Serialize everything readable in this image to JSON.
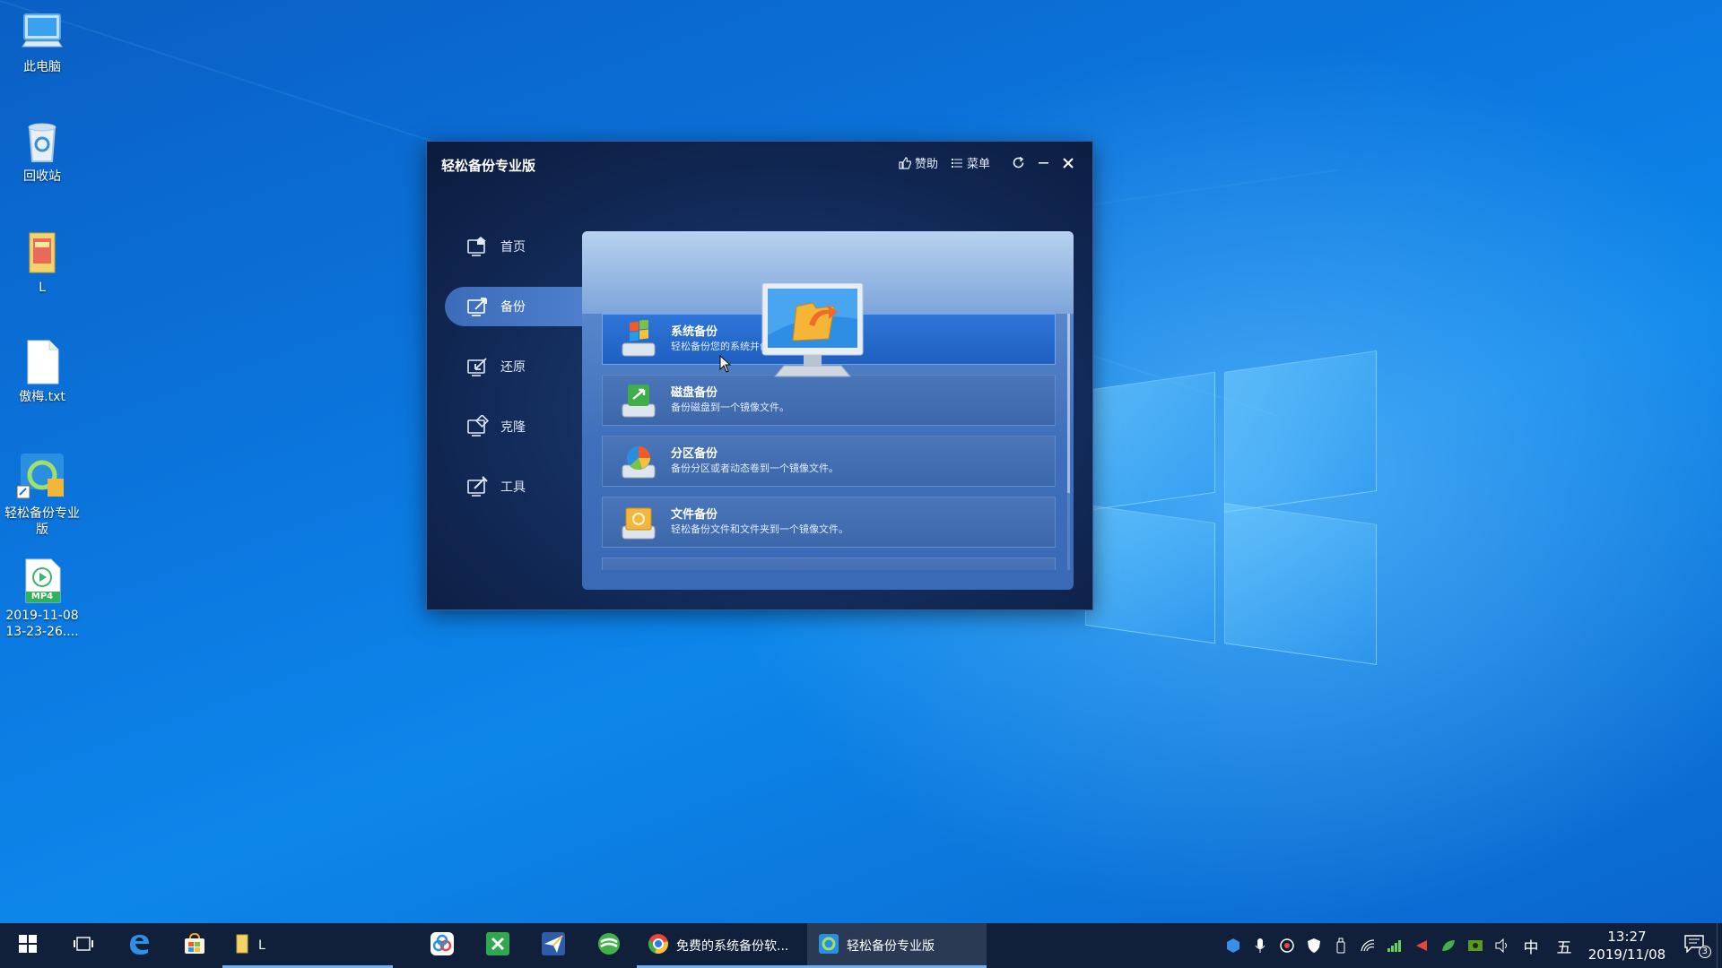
{
  "desktop": {
    "icons": [
      {
        "label": "此电脑",
        "icon": "computer-icon"
      },
      {
        "label": "回收站",
        "icon": "recycle-bin-icon"
      },
      {
        "label": "L",
        "icon": "folder-icon"
      },
      {
        "label": "傲梅.txt",
        "icon": "text-file-icon"
      },
      {
        "label": "轻松备份专业版",
        "icon": "backup-app-shortcut-icon"
      },
      {
        "label": "2019-11-08 13-23-26....",
        "icon": "mp4-file-icon",
        "badge": "MP4"
      }
    ]
  },
  "app": {
    "title": "轻松备份专业版",
    "toolbar": {
      "like_label": "赞助",
      "menu_label": "菜单"
    },
    "nav": [
      {
        "label": "首页",
        "active": false
      },
      {
        "label": "备份",
        "active": true
      },
      {
        "label": "还原",
        "active": false
      },
      {
        "label": "克隆",
        "active": false
      },
      {
        "label": "工具",
        "active": false
      }
    ],
    "options": [
      {
        "title": "系统备份",
        "desc": "轻松备份您的系统并创建系统分区的镜像。",
        "selected": true
      },
      {
        "title": "磁盘备份",
        "desc": "备份磁盘到一个镜像文件。",
        "selected": false
      },
      {
        "title": "分区备份",
        "desc": "备份分区或者动态卷到一个镜像文件。",
        "selected": false
      },
      {
        "title": "文件备份",
        "desc": "轻松备份文件和文件夹到一个镜像文件。",
        "selected": false
      }
    ]
  },
  "taskbar": {
    "apps": [
      {
        "label": "L",
        "icon": "folder-icon"
      },
      {
        "label": "免费的系统备份软...",
        "icon": "chrome-icon"
      },
      {
        "label": "轻松备份专业版",
        "icon": "backup-app-icon"
      }
    ],
    "tray": {
      "ime": "中",
      "ime2": "五",
      "time": "13:27",
      "date": "2019/11/08",
      "notifications": "3"
    }
  },
  "colors": {
    "desktop_bg": "#0b78e0",
    "window_bg": "#122a58",
    "selected_item": "#2e76d8",
    "taskbar_bg": "#10203a"
  }
}
